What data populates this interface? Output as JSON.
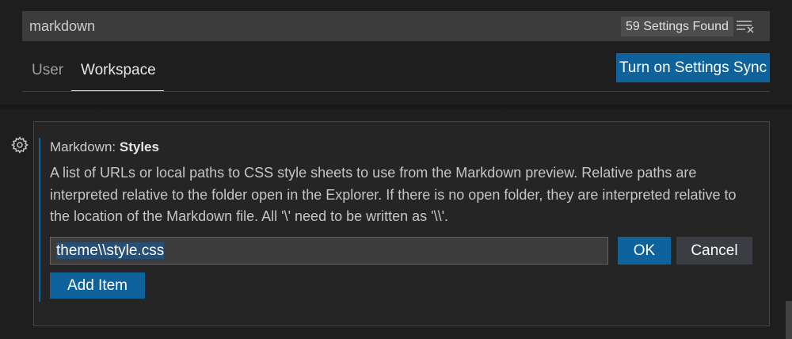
{
  "search": {
    "value": "markdown",
    "results_count": "59 Settings Found",
    "clear_icon": "clear-filter-icon"
  },
  "tabs": [
    {
      "label": "User",
      "active": false
    },
    {
      "label": "Workspace",
      "active": true
    }
  ],
  "sync_button": {
    "label": "Turn on Settings Sync"
  },
  "setting": {
    "gear_icon": "gear-icon",
    "category": "Markdown: ",
    "name": "Styles",
    "description": "A list of URLs or local paths to CSS style sheets to use from the Markdown preview. Relative paths are interpreted relative to the folder open in the Explorer. If there is no open folder, they are interpreted relative to the location of the Markdown file. All '\\' need to be written as '\\\\'.",
    "item_value": "theme\\\\style.css",
    "ok_label": "OK",
    "cancel_label": "Cancel",
    "add_item_label": "Add Item"
  },
  "colors": {
    "accent": "#0e639c",
    "focus_border": "#007fd4",
    "background": "#1e1e1e",
    "input_background": "#3c3c3c"
  }
}
